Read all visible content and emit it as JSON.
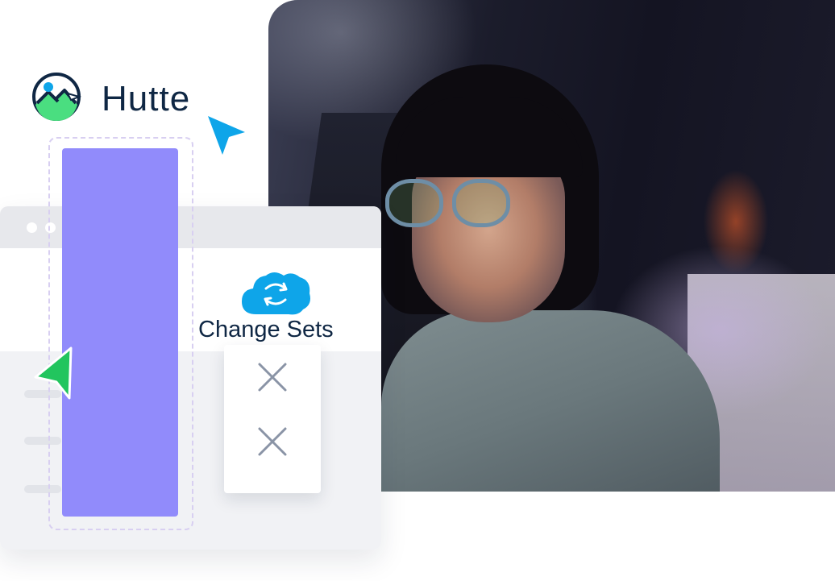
{
  "logo": {
    "name": "Hutte",
    "icon": "hutte-mountain-logo-icon"
  },
  "change_sets": {
    "label": "Change Sets",
    "icon": "salesforce-sync-cloud-icon",
    "rows": [
      {
        "icon": "x-icon"
      },
      {
        "icon": "x-icon"
      }
    ]
  },
  "colors": {
    "brand_navy": "#0f2744",
    "purple_bar": "#918bfb",
    "salesforce_blue": "#0ea5e9",
    "cursor_blue": "#0ea5e9",
    "cursor_green": "#22c55e",
    "logo_green": "#4ade80"
  },
  "cursors": [
    {
      "icon": "blue-pointer-cursor-icon"
    },
    {
      "icon": "green-pointer-cursor-icon"
    }
  ],
  "photo": {
    "subject": "developer-photo"
  }
}
